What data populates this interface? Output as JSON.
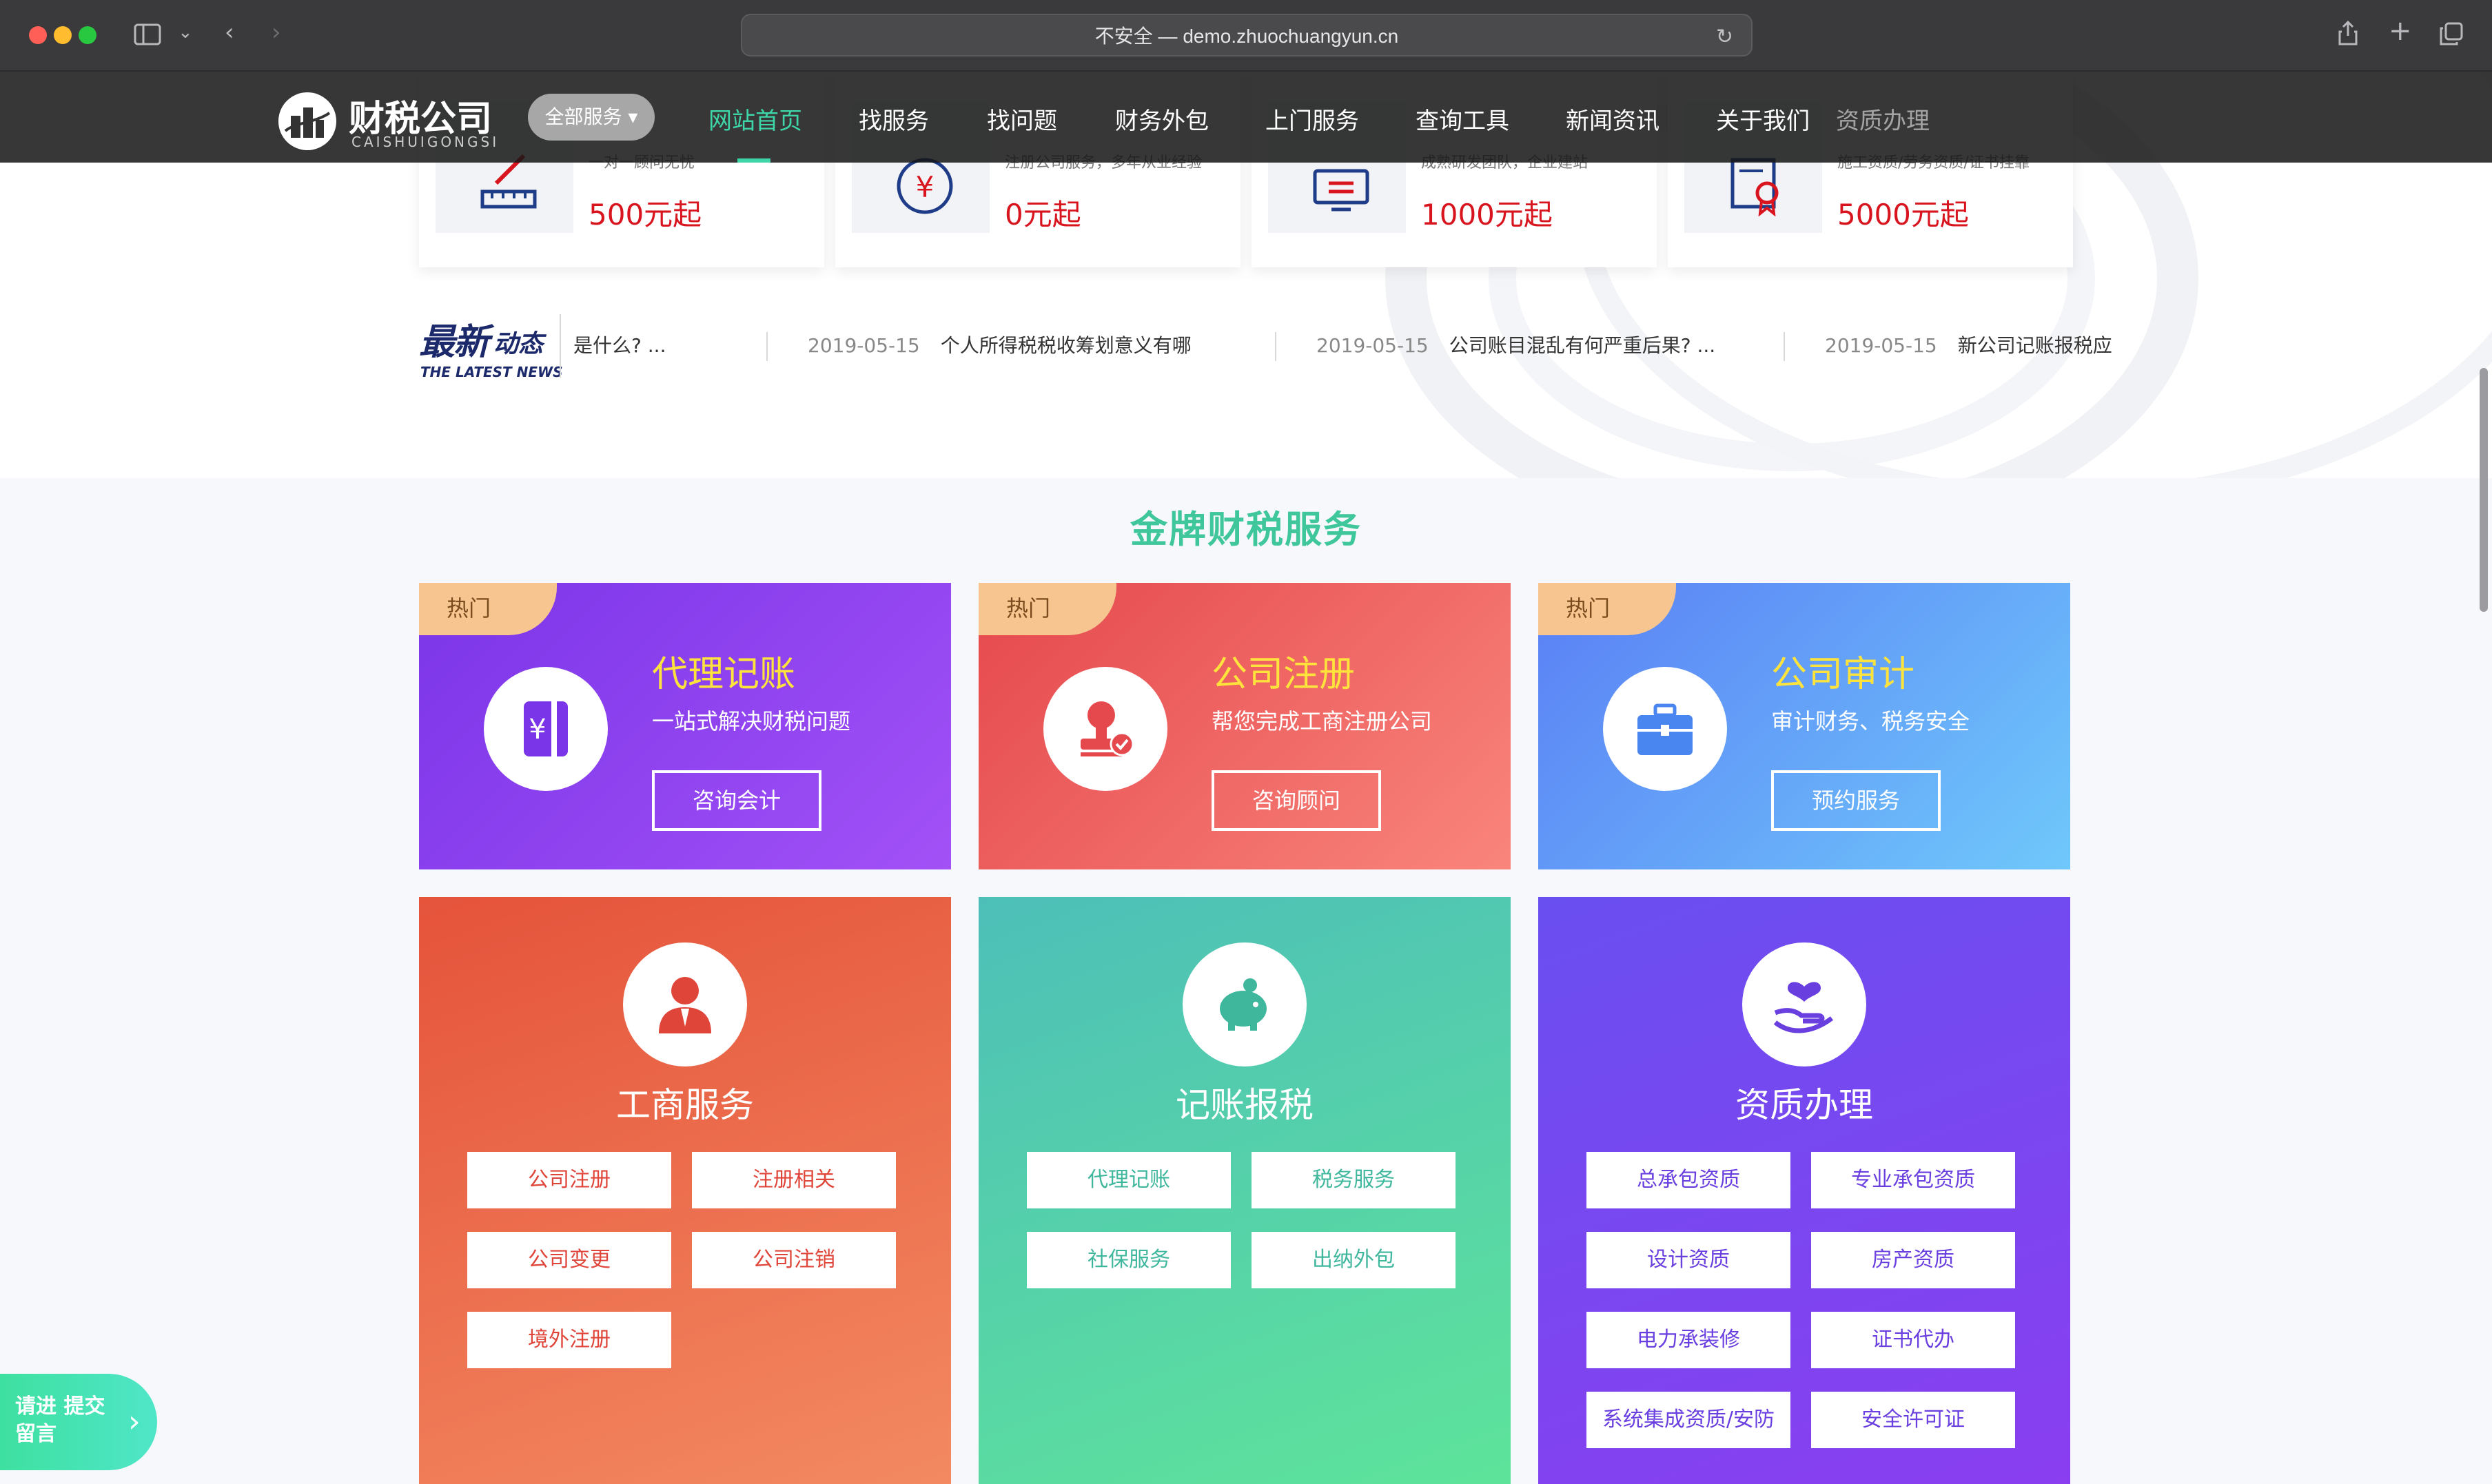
{
  "browser": {
    "url": "不安全 — demo.zhuochuangyun.cn",
    "colors": {
      "close": "#ff5f57",
      "minimize": "#febc2e",
      "maximize": "#28c840"
    }
  },
  "nav": {
    "logo_name": "财税公司",
    "logo_subtitle": "CAISHUIGONGSI",
    "all_services": "全部服务 ▾",
    "items": [
      "网站首页",
      "找服务",
      "找问题",
      "财务外包",
      "上门服务",
      "查询工具",
      "新闻资讯",
      "关于我们",
      "资质办理"
    ],
    "active_index": 0,
    "accent": "#3ed6a8"
  },
  "products": [
    {
      "desc": "一对一顾问无忧",
      "price": "500元起",
      "icon": "ruler-pencil-icon"
    },
    {
      "desc": "注册公司服务，多年从业经验",
      "price": "0元起",
      "icon": "yuan-coin-icon"
    },
    {
      "desc": "成熟研发团队，企业建站",
      "price": "1000元起",
      "icon": "monitor-icon"
    },
    {
      "desc": "施工资质/劳务资质/证书挂靠",
      "price": "5000元起",
      "icon": "certificate-icon"
    }
  ],
  "news": {
    "logo_big": "最新",
    "logo_small": "动态",
    "logo_en": "THE LATEST NEWS",
    "items": [
      {
        "date": "",
        "title": "是什么? ..."
      },
      {
        "date": "2019-05-15",
        "title": "个人所得税税收筹划意义有哪"
      },
      {
        "date": "2019-05-15",
        "title": "公司账目混乱有何严重后果? ..."
      },
      {
        "date": "2019-05-15",
        "title": "新公司记账报税应"
      }
    ]
  },
  "section_title": "金牌财税服务",
  "promos": [
    {
      "hot": "热门",
      "title": "代理记账",
      "subtitle": "一站式解决财税问题",
      "button": "咨询会计",
      "icon": "ledger-icon",
      "colors": [
        "#7b35e8",
        "#a251f6"
      ]
    },
    {
      "hot": "热门",
      "title": "公司注册",
      "subtitle": "帮您完成工商注册公司",
      "button": "咨询顾问",
      "icon": "stamp-icon",
      "colors": [
        "#e5484d",
        "#f9857c"
      ]
    },
    {
      "hot": "热门",
      "title": "公司审计",
      "subtitle": "审计财务、税务安全",
      "button": "预约服务",
      "icon": "briefcase-icon",
      "colors": [
        "#5a7ff5",
        "#6fc8fb"
      ]
    }
  ],
  "categories": [
    {
      "title": "工商服务",
      "icon": "person-suit-icon",
      "text_color": "#e0453a",
      "colors": [
        "#e5533b",
        "#f38a61"
      ],
      "buttons": [
        "公司注册",
        "注册相关",
        "公司变更",
        "公司注销",
        "境外注册"
      ]
    },
    {
      "title": "记账报税",
      "icon": "piggy-bank-icon",
      "text_color": "#3fb79d",
      "colors": [
        "#4dbfb8",
        "#5ee49a"
      ],
      "buttons": [
        "代理记账",
        "税务服务",
        "社保服务",
        "出纳外包"
      ]
    },
    {
      "title": "资质办理",
      "icon": "heart-hand-icon",
      "text_color": "#6a3fe0",
      "colors": [
        "#6a4ff0",
        "#8a3ef0"
      ],
      "buttons": [
        "总承包资质",
        "专业承包资质",
        "设计资质",
        "房产资质",
        "电力承装修",
        "证书代办",
        "系统集成资质/安防",
        "安全许可证"
      ]
    }
  ],
  "feedback": {
    "label": "请进 提交留言"
  }
}
